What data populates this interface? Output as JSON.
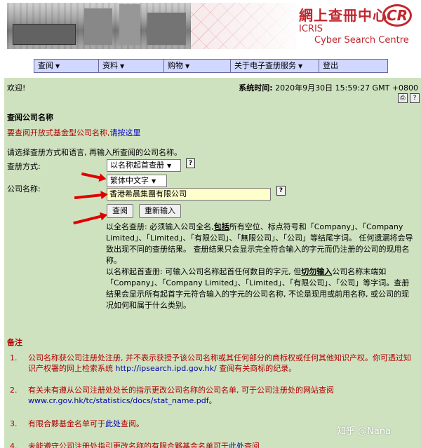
{
  "banner": {
    "brand_cn": "網上查冊中心",
    "brand_logo": "CR",
    "brand_en_line1": "ICRIS",
    "brand_en_line2": "Cyber Search Centre"
  },
  "nav": {
    "items": [
      {
        "label": "查阅",
        "has_dropdown": true
      },
      {
        "label": "资料",
        "has_dropdown": true
      },
      {
        "label": "购物",
        "has_dropdown": true
      },
      {
        "label": "关于电子查册服务",
        "has_dropdown": true
      },
      {
        "label": "登出",
        "has_dropdown": false
      }
    ]
  },
  "status": {
    "welcome": "欢迎!",
    "systime_label": "系统时间:",
    "systime_value": "2020年9月30日 15:59:27 GMT +0800"
  },
  "form": {
    "title": "查阅公司名称",
    "fund_text": "要查阅开放式基金型公司名称,",
    "fund_link": "请按这里",
    "intro": "请选择查册方式和语言, 再输入所查阅的公司名称。",
    "method_label": "查册方式:",
    "method_value": "以名称起首查册",
    "language_value": "繁体中文字",
    "name_label": "公司名称:",
    "name_value": "香港希晨集團有限公司",
    "search_button": "查阅",
    "reset_button": "重新输入"
  },
  "notes": {
    "full_name_prefix": "以全名查册: 必须输入公司全名,",
    "full_name_bold": "包括",
    "full_name_rest": "所有空位、标点符号和「Company」、「Company Limited」、「Limited」、「有限公司」、「無限公司」、「公司」等结尾字词。 任何遗漏将会导致出现不同的查册结果。 查册结果只会显示完全符合输入的字元而仍注册的公司的现用名称。",
    "prefix_name_prefix": "以名称起首查册: 可输入公司名称起首任何数目的字元, 但",
    "prefix_name_bold": "切勿输入",
    "prefix_name_rest": "公司名称末端如「Company」、「Company Limited」、「Limited」、「有限公司」、「公司」等字词。查册结果会显示所有起首字元符合输入的字元的公司名称, 不论是现用或前用名称, 或公司的现况如何和属于什么类别。"
  },
  "remarks": {
    "title": "备注",
    "items": [
      {
        "num": "1.",
        "text": "公司名称获公司注册处注册, 并不表示获授予该公司名称或其任何部分的商标权或任何其他知识产权。你可透过知识产权署的网上检索系统",
        "link": "http://ipsearch.ipd.gov.hk/",
        "tail": "查阅有关商标的纪录。"
      },
      {
        "num": "2.",
        "text": "有关未有遵从公司注册处处长的指示更改公司名称的公司名单, 可于公司注册处的网站查阅",
        "link": "www.cr.gov.hk/tc/statistics/docs/stat_name.pdf",
        "tail": "。"
      },
      {
        "num": "3.",
        "text": "有限合夥基金名单可于",
        "link": "此处",
        "tail": "查阅。"
      },
      {
        "num": "4.",
        "text": "未能遵守公司注册处指引更改名称的有限合夥基金名单可于",
        "link": "此处",
        "tail": "查阅"
      }
    ]
  },
  "watermark": "知乎 @Nana",
  "colors": {
    "panel_bg": "#cfe2c0",
    "nav_bg": "#d0d8ff",
    "brand_red": "#c1272d",
    "remark_red": "#b00000",
    "input_bg": "#ffffcc",
    "arrow_red": "#e00000"
  }
}
